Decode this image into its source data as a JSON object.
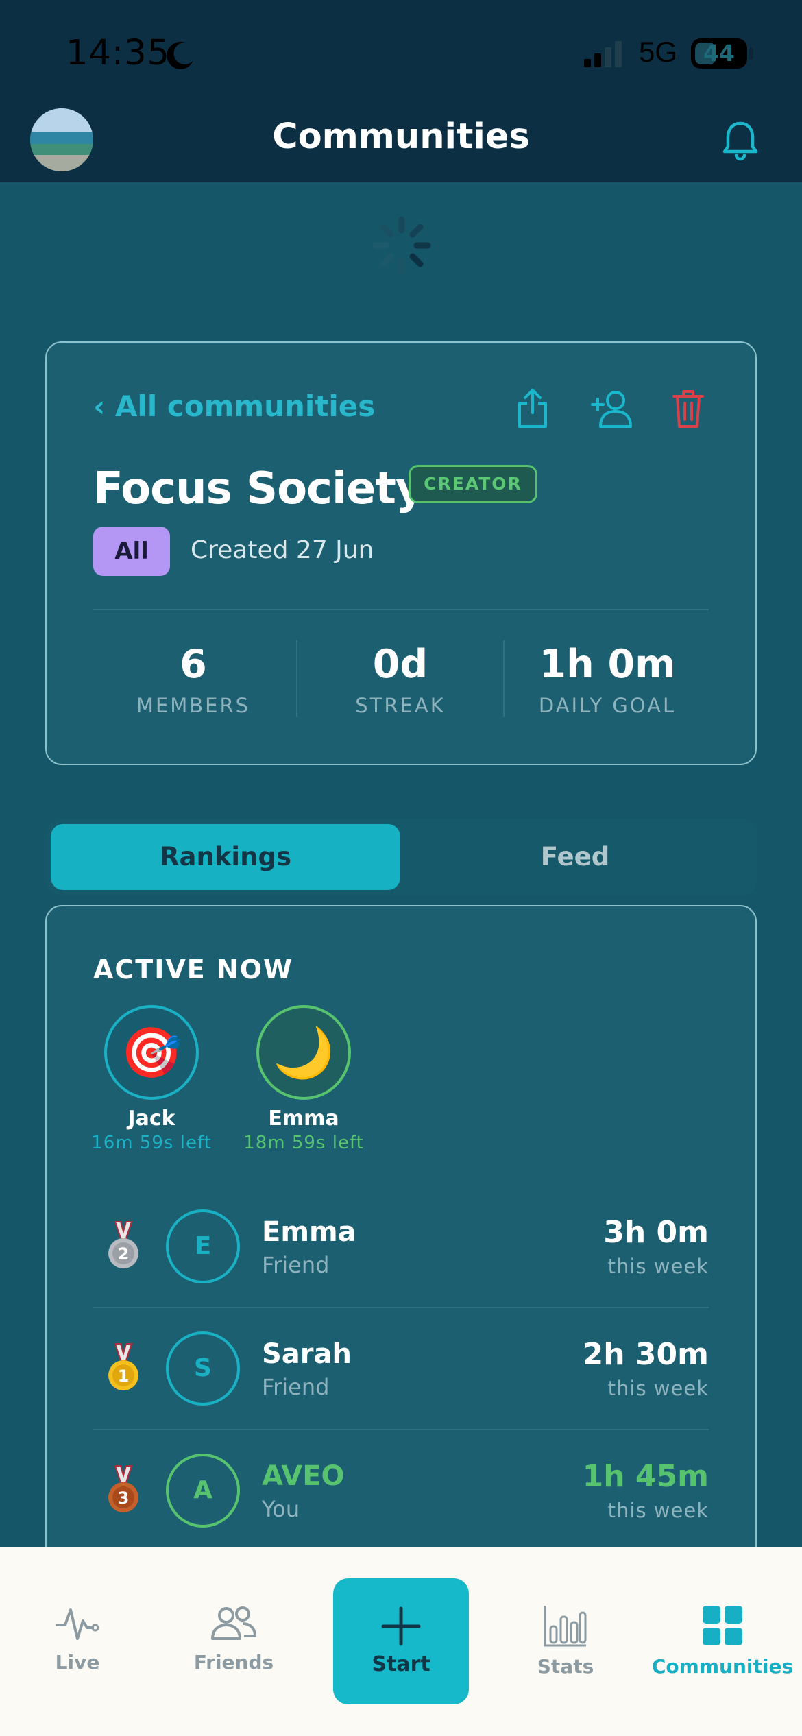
{
  "status_bar": {
    "time": "14:35",
    "network": "5G",
    "battery": "44"
  },
  "header": {
    "title": "Communities"
  },
  "community": {
    "back_label": "‹ All communities",
    "name": "Focus Society",
    "role_badge": "CREATOR",
    "filter_chip": "All",
    "created": "Created 27 Jun",
    "stats": [
      {
        "value": "6",
        "label": "MEMBERS"
      },
      {
        "value": "0d",
        "label": "STREAK"
      },
      {
        "value": "1h 0m",
        "label": "DAILY GOAL"
      }
    ]
  },
  "tabs": [
    {
      "label": "Rankings",
      "selected": true
    },
    {
      "label": "Feed",
      "selected": false
    }
  ],
  "active_now": {
    "heading": "ACTIVE NOW",
    "users": [
      {
        "name": "Jack",
        "time_left": "16m 59s left",
        "emoji": "🎯",
        "color": "#1bb1c4"
      },
      {
        "name": "Emma",
        "time_left": "18m 59s left",
        "emoji": "🌙",
        "color": "#58c36f"
      }
    ]
  },
  "rankings": [
    {
      "rank": "2",
      "initial": "E",
      "name": "Emma",
      "relation": "Friend",
      "time": "3h 0m",
      "period": "this week",
      "medal": "silver"
    },
    {
      "rank": "1",
      "initial": "S",
      "name": "Sarah",
      "relation": "Friend",
      "time": "2h 30m",
      "period": "this week",
      "medal": "gold"
    },
    {
      "rank": "3",
      "initial": "A",
      "name": "AVEO",
      "relation": "You",
      "time": "1h 45m",
      "period": "this week",
      "medal": "bronze"
    }
  ],
  "bottom_nav": [
    {
      "label": "Live",
      "icon": "pulse-icon",
      "active": false
    },
    {
      "label": "Friends",
      "icon": "people-icon",
      "active": false
    },
    {
      "label": "Start",
      "icon": "plus-icon",
      "active": false
    },
    {
      "label": "Stats",
      "icon": "bar-chart-icon",
      "active": false
    },
    {
      "label": "Communities",
      "icon": "grid-icon",
      "active": true
    }
  ],
  "colors": {
    "accent": "#16b9c9",
    "green": "#58c36f",
    "danger": "#d9414a",
    "background": "#155768",
    "header": "#0c2f43"
  }
}
